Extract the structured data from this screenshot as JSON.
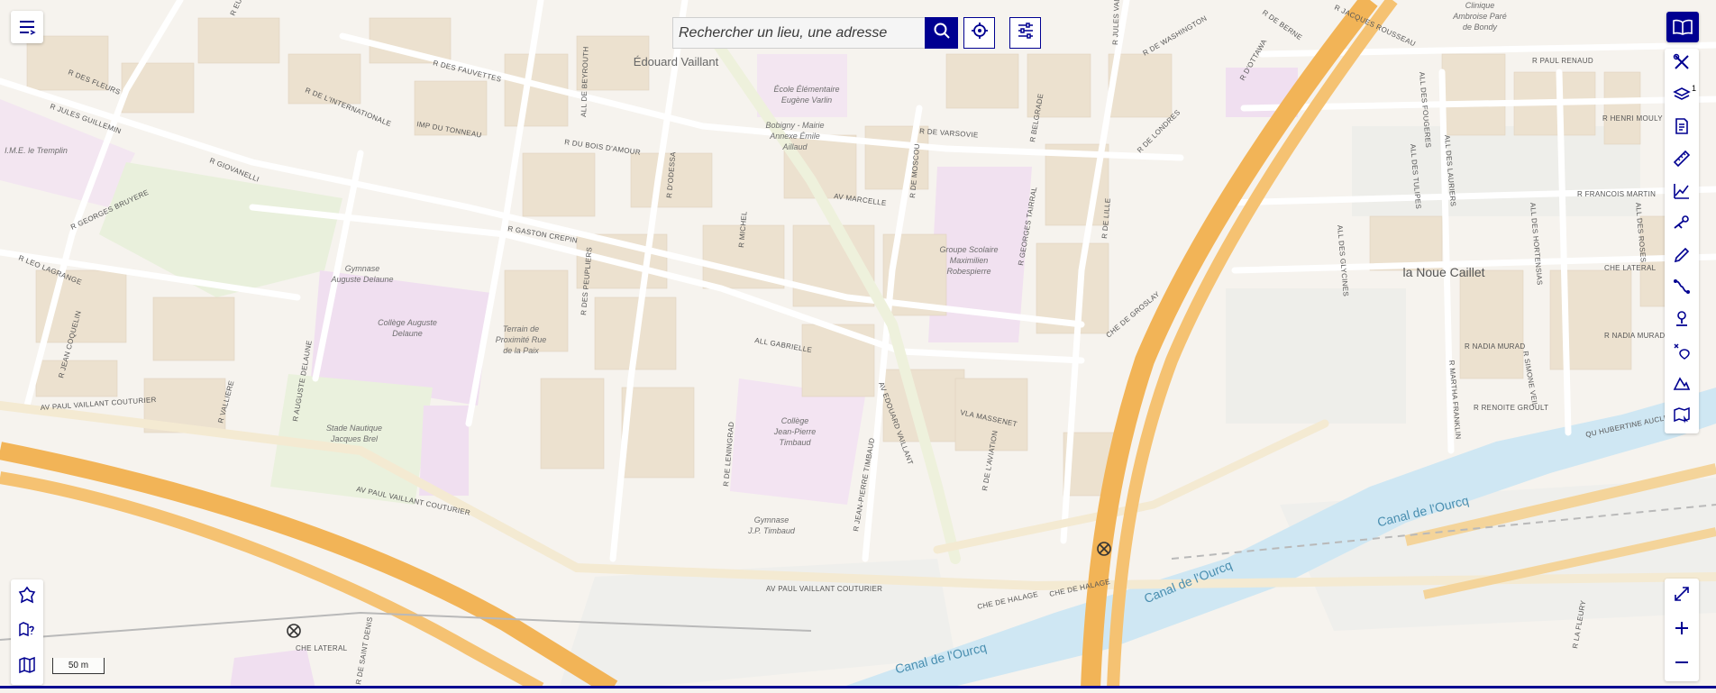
{
  "search": {
    "placeholder": "Rechercher un lieu, une adresse"
  },
  "controls": {
    "menu_icon": "menu-lines-icon",
    "geolocate_icon": "crosshair-icon",
    "filters_icon": "sliders-icon",
    "catalog_icon": "open-book-icon",
    "fullscreen_icon": "expand-arrows-icon"
  },
  "right_tools": [
    {
      "name": "tools-icon",
      "badge": ""
    },
    {
      "name": "layers-icon",
      "badge": "1"
    },
    {
      "name": "legend-icon",
      "badge": ""
    },
    {
      "name": "ruler-icon",
      "badge": ""
    },
    {
      "name": "elevation-profile-icon",
      "badge": ""
    },
    {
      "name": "isochrone-icon",
      "badge": ""
    },
    {
      "name": "draw-pencil-icon",
      "badge": ""
    },
    {
      "name": "route-icon",
      "badge": ""
    },
    {
      "name": "point-marker-icon",
      "badge": ""
    },
    {
      "name": "coordinates-icon",
      "badge": ""
    },
    {
      "name": "terrain-icon",
      "badge": ""
    },
    {
      "name": "map-select-icon",
      "badge": ""
    }
  ],
  "scale": {
    "label": "50 m"
  },
  "colors": {
    "accent": "#000091",
    "background": "#f6f3ee",
    "highway": "#f2b457",
    "water": "#cfe7f3",
    "school_area": "#f1e2f0",
    "building": "#ede3d2"
  },
  "map_labels": {
    "streets": [
      "R DES FLEURS",
      "R JULES GUILLEMIN",
      "R EUGENE POTT",
      "R DES FAUVETTES",
      "R DE L'INTERNATIONALE",
      "IMP DU TONNEAU",
      "R DU BOIS D'AMOUR",
      "R GIOVANELLI",
      "R GEORGES BRUYERE",
      "R LEO LAGRANGE",
      "R GASTON CREPIN",
      "R JEAN COQUELIN",
      "R VALLIERE",
      "R AUGUSTE DELAUNE",
      "AV PAUL VAILLANT COUTURIER",
      "ALL DE BEYROUTH",
      "R D'ODESSA",
      "R MICHEL",
      "R DES PEUPLIERS",
      "ALL GABRIELLE",
      "R DE LENINGRAD",
      "R JEAN-PIERRE TIMBAUD",
      "AV EDOUARD VAILLANT",
      "AV MARCELLE",
      "R DE MOSCOU",
      "R DE VARSOVIE",
      "R BELGRADE",
      "R GEORGES TAIRRAL",
      "R DE LILLE",
      "VLA MASSENET",
      "R DE L'AVIATION",
      "CHE DE GROSLAY",
      "CHE DE HALAGE",
      "R DE WASHINGTON",
      "R DE LONDRES",
      "R D'OTTAWA",
      "R DE BERNE",
      "R JULES VALLES",
      "R JACQUES ROUSSEAU",
      "R PAUL RENAUD",
      "R HENRI MOULY",
      "R FRANCOIS MARTIN",
      "CHE LATERAL",
      "R NADIA MURAD",
      "R MARTHA FRANKLIN",
      "R SIMONE VEIL",
      "R RENOITE GROULT",
      "QU HUBERTINE AUCLERT",
      "ALL DES FOUGERES",
      "ALL DES LAURIERS",
      "ALL DES TULIPES",
      "ALL DES GLYCINES",
      "ALL DES HORTENSIAS",
      "ALL DES ROSES",
      "R LA FLEURY",
      "R DE SAINT DENIS",
      "AV MARCELLE"
    ],
    "places": [
      "Édouard Vaillant",
      "École Élémentaire",
      "Eugène Varlin",
      "Bobigny - Mairie",
      "Annexe Émile",
      "Aillaud",
      "I.M.E. le Tremplin",
      "Gymnase",
      "Auguste Delaune",
      "Collège Auguste",
      "Delaune",
      "Terrain de",
      "Proximité Rue",
      "de la Paix",
      "Stade Nautique",
      "Jacques Brel",
      "Collège",
      "Jean-Pierre",
      "Timbaud",
      "Gymnase",
      "J.P. Timbaud",
      "Groupe Scolaire",
      "Maximilien",
      "Robespierre",
      "la Noue Caillet",
      "Clinique",
      "Ambroise Paré",
      "de Bondy",
      "Canal de l'Ourcq"
    ]
  }
}
